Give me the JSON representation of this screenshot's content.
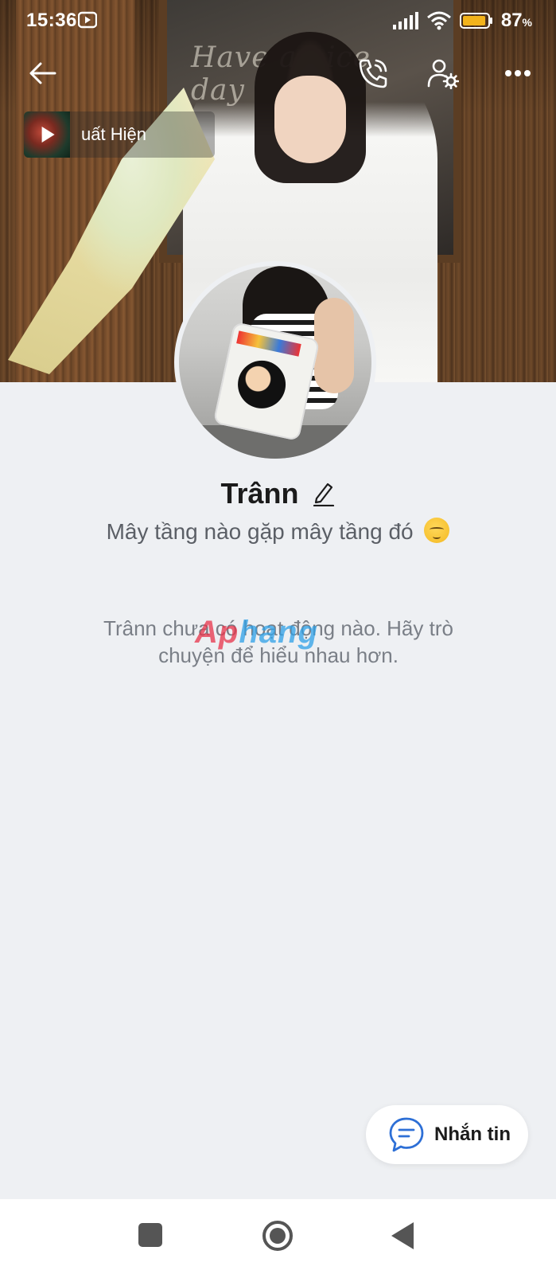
{
  "status_bar": {
    "time": "15:36",
    "battery_percent": "87",
    "battery_unit": "%",
    "app_icon": "youtube-icon"
  },
  "top_nav": {
    "back_icon": "arrow-left-icon",
    "call_icon": "phone-call-icon",
    "settings_icon": "user-settings-icon",
    "more_icon": "more-dots-icon"
  },
  "music": {
    "title": "uất Hiện",
    "play_icon": "play-icon"
  },
  "cover_text": "Have a nice day",
  "profile": {
    "name": "Trânn",
    "bio": "Mây tầng nào gặp mây tầng đó",
    "bio_emoji": "pensive-face-emoji",
    "edit_icon": "pencil-icon"
  },
  "empty_message": "Trânn chưa có hoạt động nào. Hãy trò chuyện để hiểu nhau hơn.",
  "watermark": {
    "part_a": "Ap",
    "part_b": "hang"
  },
  "message_button": {
    "label": "Nhắn tin",
    "icon": "chat-bubble-icon"
  },
  "colors": {
    "background": "#eef0f3",
    "accent": "#2d6fd6",
    "text_primary": "#1b1b1b",
    "text_secondary": "#5b5f66"
  }
}
